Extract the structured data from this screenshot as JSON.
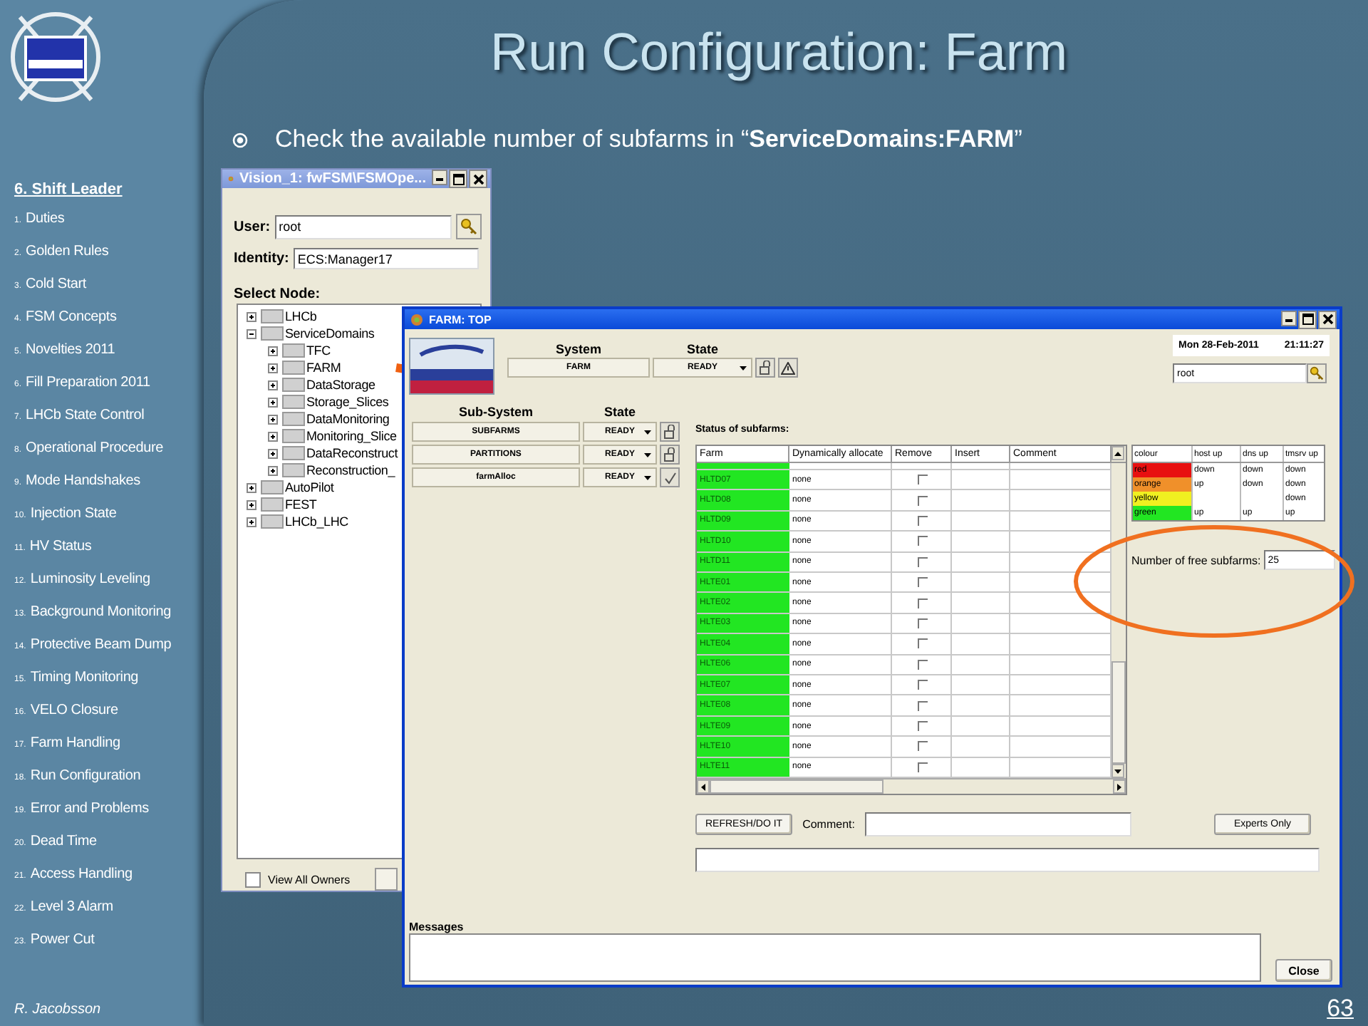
{
  "slide": {
    "title": "Run Configuration: Farm",
    "bullet": "Check the available number of subfarms in “**ServiceDomains:FARM**”",
    "page_number": "63",
    "author": "R. Jacobsson"
  },
  "sidebar": {
    "heading": "6. Shift Leader",
    "items": [
      {
        "number": "1.",
        "label": "Duties"
      },
      {
        "number": "2.",
        "label": "Golden Rules"
      },
      {
        "number": "3.",
        "label": "Cold Start"
      },
      {
        "number": "4.",
        "label": "FSM Concepts"
      },
      {
        "number": "5.",
        "label": "Novelties 2011"
      },
      {
        "number": "6.",
        "label": "Fill Preparation 2011"
      },
      {
        "number": "7.",
        "label": "LHCb State Control"
      },
      {
        "number": "8.",
        "label": "Operational Procedure"
      },
      {
        "number": "9.",
        "label": "Mode Handshakes"
      },
      {
        "number": "10.",
        "label": "Injection State"
      },
      {
        "number": "11.",
        "label": "HV Status"
      },
      {
        "number": "12.",
        "label": "Luminosity Leveling"
      },
      {
        "number": "13.",
        "label": "Background Monitoring"
      },
      {
        "number": "14.",
        "label": "Protective Beam Dump"
      },
      {
        "number": "15.",
        "label": "Timing Monitoring"
      },
      {
        "number": "16.",
        "label": "VELO Closure"
      },
      {
        "number": "17.",
        "label": "Farm Handling"
      },
      {
        "number": "18.",
        "label": "Run Configuration"
      },
      {
        "number": "19.",
        "label": "Error and Problems"
      },
      {
        "number": "20.",
        "label": "Dead Time"
      },
      {
        "number": "21.",
        "label": "Access Handling"
      },
      {
        "number": "22.",
        "label": "Level 3 Alarm"
      },
      {
        "number": "23.",
        "label": "Power Cut"
      }
    ]
  },
  "vision_window": {
    "title": "Vision_1: fwFSM\\FSMOpe...",
    "user_label": "User:",
    "user": "root",
    "identity_label": "Identity:",
    "identity": "ECS:Manager17",
    "select_node_label": "Select Node:",
    "tree": [
      {
        "label": "LHCb",
        "expanded": false
      },
      {
        "label": "ServiceDomains",
        "expanded": true,
        "children": [
          {
            "label": "TFC",
            "expanded": false
          },
          {
            "label": "FARM",
            "expanded": false
          },
          {
            "label": "DataStorage",
            "expanded": false
          },
          {
            "label": "Storage_Slices",
            "expanded": false
          },
          {
            "label": "DataMonitoring",
            "expanded": false
          },
          {
            "label": "Monitoring_Slice",
            "expanded": false
          },
          {
            "label": "DataReconstruct",
            "expanded": false
          },
          {
            "label": "Reconstruction_",
            "expanded": false
          }
        ]
      },
      {
        "label": "AutoPilot",
        "expanded": false
      },
      {
        "label": "FEST",
        "expanded": false
      },
      {
        "label": "LHCb_LHC",
        "expanded": false
      }
    ],
    "view_all_owners": {
      "label": "View All Owners",
      "checked": false
    }
  },
  "farm_window": {
    "title": "FARM: TOP",
    "system": {
      "heading": "System",
      "state_heading": "State",
      "name": "FARM",
      "state": "READY"
    },
    "subsystems": {
      "heading": "Sub-System",
      "state_heading": "State",
      "rows": [
        {
          "name": "SUBFARMS",
          "state": "READY",
          "kind": "lock"
        },
        {
          "name": "PARTITIONS",
          "state": "READY",
          "kind": "lock"
        },
        {
          "name": "farmAlloc",
          "state": "READY",
          "kind": "check"
        }
      ]
    },
    "date": "Mon 28-Feb-2011",
    "time": "21:11:27",
    "user": "root",
    "status_label": "Status of subfarms:",
    "columns": [
      "Farm",
      "Dynamically allocate",
      "Remove",
      "Insert",
      "Comment"
    ],
    "rows": [
      {
        "farm": "HLTD07",
        "color": "#22e622",
        "allocated": "none",
        "remove": false
      },
      {
        "farm": "HLTD08",
        "color": "#22e622",
        "allocated": "none",
        "remove": false
      },
      {
        "farm": "HLTD09",
        "color": "#22e622",
        "allocated": "none",
        "remove": false
      },
      {
        "farm": "HLTD10",
        "color": "#22e622",
        "allocated": "none",
        "remove": false
      },
      {
        "farm": "HLTD11",
        "color": "#22e622",
        "allocated": "none",
        "remove": false
      },
      {
        "farm": "HLTE01",
        "color": "#22e622",
        "allocated": "none",
        "remove": false
      },
      {
        "farm": "HLTE02",
        "color": "#22e622",
        "allocated": "none",
        "remove": false
      },
      {
        "farm": "HLTE03",
        "color": "#22e622",
        "allocated": "none",
        "remove": false
      },
      {
        "farm": "HLTE04",
        "color": "#22e622",
        "allocated": "none",
        "remove": false
      },
      {
        "farm": "HLTE06",
        "color": "#22e622",
        "allocated": "none",
        "remove": false
      },
      {
        "farm": "HLTE07",
        "color": "#22e622",
        "allocated": "none",
        "remove": false
      },
      {
        "farm": "HLTE08",
        "color": "#22e622",
        "allocated": "none",
        "remove": false
      },
      {
        "farm": "HLTE09",
        "color": "#22e622",
        "allocated": "none",
        "remove": false
      },
      {
        "farm": "HLTE10",
        "color": "#22e622",
        "allocated": "none",
        "remove": false
      },
      {
        "farm": "HLTE11",
        "color": "#22e622",
        "allocated": "none",
        "remove": false
      }
    ],
    "legend_columns": [
      "colour",
      "host up",
      "dns up",
      "tmsrv up"
    ],
    "legend_rows": [
      {
        "colour": "red",
        "color": "#e81010",
        "host_up": "down",
        "dns_up": "down",
        "tmsrv_up": "down"
      },
      {
        "colour": "orange",
        "color": "#f0902a",
        "host_up": "up",
        "dns_up": "down",
        "tmsrv_up": "down"
      },
      {
        "colour": "yellow",
        "color": "#f0f020",
        "tmsrv_up": "down"
      },
      {
        "colour": "green",
        "color": "#22e622",
        "host_up": "up",
        "dns_up": "up",
        "tmsrv_up": "up"
      }
    ],
    "free_label": "Number of free subfarms:",
    "free_value": "25",
    "refresh": "REFRESH/DO IT",
    "comment_label": "Comment:",
    "experts": "Experts Only",
    "messages_label": "Messages",
    "close": "Close"
  }
}
